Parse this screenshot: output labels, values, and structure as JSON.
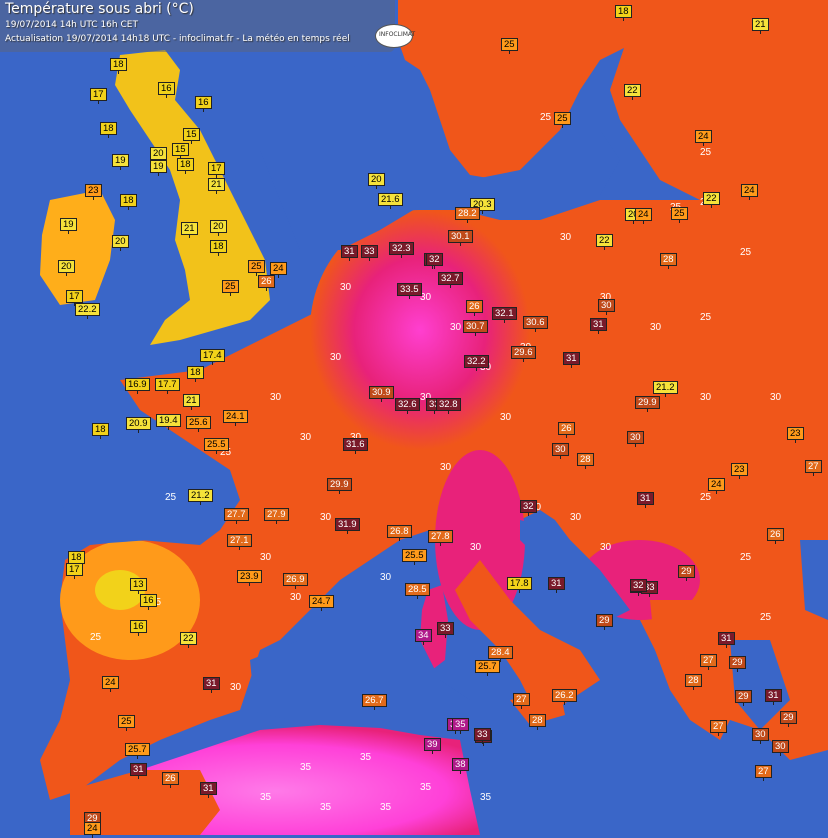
{
  "header": {
    "title": "Température sous abri (°C)",
    "time_line": "19/07/2014  14h UTC  16h CET",
    "update_line": "Actualisation 19/07/2014 14h18 UTC - infoclimat.fr - La météo en temps réel",
    "logo_text": "INFOCLIMAT"
  },
  "colors": {
    "sea": "#3a66c8",
    "cool": "#f2d21a",
    "mild": "#ff9a1a",
    "warm": "#f0561a",
    "hot": "#e8227a",
    "veryhot": "#ff55e0",
    "station_hot_box": "#7a1a2a"
  },
  "isotherm_labels": [
    "25",
    "30",
    "35"
  ],
  "stations": [
    {
      "v": "18"
    },
    {
      "v": "17"
    },
    {
      "v": "16"
    },
    {
      "v": "16"
    },
    {
      "v": "18"
    },
    {
      "v": "15"
    },
    {
      "v": "15"
    },
    {
      "v": "19"
    },
    {
      "v": "20"
    },
    {
      "v": "18"
    },
    {
      "v": "19"
    },
    {
      "v": "17"
    },
    {
      "v": "21"
    },
    {
      "v": "23"
    },
    {
      "v": "18"
    },
    {
      "v": "19"
    },
    {
      "v": "20"
    },
    {
      "v": "20"
    },
    {
      "v": "21"
    },
    {
      "v": "18"
    },
    {
      "v": "17"
    },
    {
      "v": "22.2"
    },
    {
      "v": "20"
    },
    {
      "v": "25"
    },
    {
      "v": "24"
    },
    {
      "v": "25"
    },
    {
      "v": "26"
    },
    {
      "v": "17.4"
    },
    {
      "v": "18"
    },
    {
      "v": "16.9"
    },
    {
      "v": "17.7"
    },
    {
      "v": "21"
    },
    {
      "v": "20.9"
    },
    {
      "v": "19.4"
    },
    {
      "v": "25.6"
    },
    {
      "v": "24.1"
    },
    {
      "v": "18"
    },
    {
      "v": "25.5"
    },
    {
      "v": "21.2"
    },
    {
      "v": "27.7"
    },
    {
      "v": "27.9"
    },
    {
      "v": "27.1"
    },
    {
      "v": "23.9"
    },
    {
      "v": "26.9"
    },
    {
      "v": "24.7"
    },
    {
      "v": "18"
    },
    {
      "v": "17"
    },
    {
      "v": "13"
    },
    {
      "v": "16"
    },
    {
      "v": "16"
    },
    {
      "v": "22"
    },
    {
      "v": "24"
    },
    {
      "v": "31"
    },
    {
      "v": "25"
    },
    {
      "v": "25.7"
    },
    {
      "v": "31"
    },
    {
      "v": "26"
    },
    {
      "v": "31"
    },
    {
      "v": "29"
    },
    {
      "v": "24"
    },
    {
      "v": "20"
    },
    {
      "v": "21.6"
    },
    {
      "v": "31"
    },
    {
      "v": "33"
    },
    {
      "v": "32.3"
    },
    {
      "v": "32"
    },
    {
      "v": "32.7"
    },
    {
      "v": "33.5"
    },
    {
      "v": "32.1"
    },
    {
      "v": "30.7"
    },
    {
      "v": "30.6"
    },
    {
      "v": "31"
    },
    {
      "v": "32.2"
    },
    {
      "v": "29.6"
    },
    {
      "v": "30.9"
    },
    {
      "v": "32.6"
    },
    {
      "v": "33"
    },
    {
      "v": "32.8"
    },
    {
      "v": "31.6"
    },
    {
      "v": "29.9"
    },
    {
      "v": "31.9"
    },
    {
      "v": "26.8"
    },
    {
      "v": "27.8"
    },
    {
      "v": "25.5"
    },
    {
      "v": "28.5"
    },
    {
      "v": "34"
    },
    {
      "v": "33"
    },
    {
      "v": "17.8"
    },
    {
      "v": "28.4"
    },
    {
      "v": "25.7"
    },
    {
      "v": "26.7"
    },
    {
      "v": "27"
    },
    {
      "v": "26.2"
    },
    {
      "v": "28"
    },
    {
      "v": "35"
    },
    {
      "v": "39"
    },
    {
      "v": "38"
    },
    {
      "v": "33"
    },
    {
      "v": "32"
    },
    {
      "v": "29"
    },
    {
      "v": "29.9"
    },
    {
      "v": "21.2"
    },
    {
      "v": "30"
    },
    {
      "v": "31"
    },
    {
      "v": "28"
    },
    {
      "v": "26"
    },
    {
      "v": "23"
    },
    {
      "v": "27"
    },
    {
      "v": "24"
    },
    {
      "v": "23"
    },
    {
      "v": "24"
    },
    {
      "v": "22"
    },
    {
      "v": "20"
    },
    {
      "v": "25"
    },
    {
      "v": "24"
    },
    {
      "v": "21"
    },
    {
      "v": "18"
    },
    {
      "v": "25"
    },
    {
      "v": "22"
    },
    {
      "v": "32"
    },
    {
      "v": "33"
    },
    {
      "v": "28"
    },
    {
      "v": "29"
    },
    {
      "v": "30"
    },
    {
      "v": "27"
    },
    {
      "v": "31"
    },
    {
      "v": "30"
    },
    {
      "v": "29"
    },
    {
      "v": "27"
    },
    {
      "v": "31"
    },
    {
      "v": "20.3"
    },
    {
      "v": "28.2"
    },
    {
      "v": "30.1"
    },
    {
      "v": "24"
    },
    {
      "v": "28"
    },
    {
      "v": "32"
    },
    {
      "v": "26"
    },
    {
      "v": "22"
    },
    {
      "v": "25"
    },
    {
      "v": "30"
    },
    {
      "v": "31"
    },
    {
      "v": "29"
    },
    {
      "v": "26"
    },
    {
      "v": "27"
    },
    {
      "v": "29"
    },
    {
      "v": "35"
    },
    {
      "v": "33"
    },
    {
      "v": "31"
    },
    {
      "v": "32"
    },
    {
      "v": "30"
    }
  ]
}
